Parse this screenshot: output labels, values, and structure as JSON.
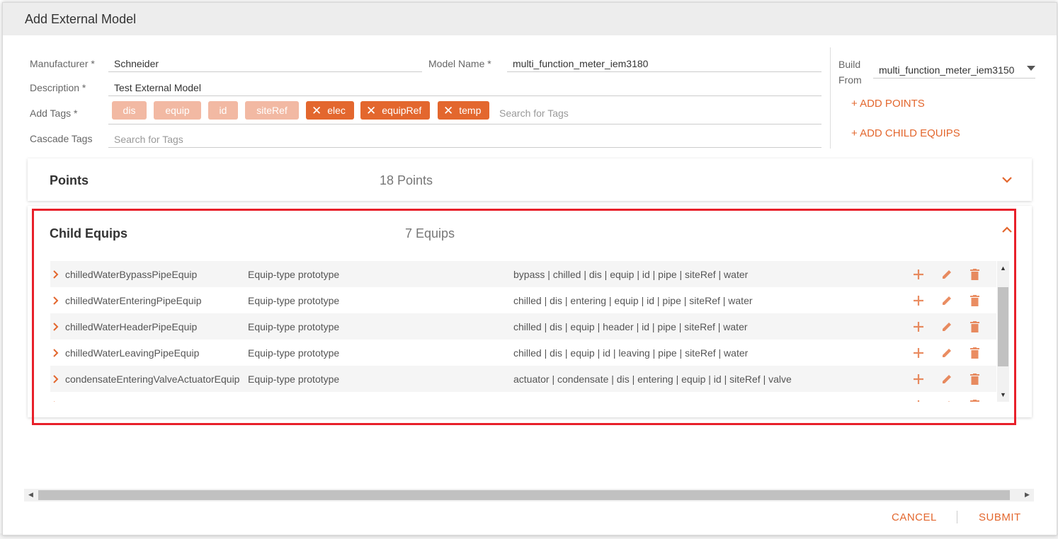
{
  "modal": {
    "title": "Add External Model"
  },
  "form": {
    "manufacturer_label": "Manufacturer *",
    "manufacturer_value": "Schneider",
    "model_name_label": "Model Name *",
    "model_name_value": "multi_function_meter_iem3180",
    "description_label": "Description *",
    "description_value": "Test External Model",
    "add_tags_label": "Add Tags *",
    "tags_fixed": [
      "dis",
      "equip",
      "id",
      "siteRef"
    ],
    "tags_removable": [
      "elec",
      "equipRef",
      "temp"
    ],
    "tags_search_placeholder": "Search for Tags",
    "cascade_tags_label": "Cascade Tags",
    "cascade_search_placeholder": "Search for Tags"
  },
  "right_panel": {
    "build_label_1": "Build",
    "build_label_2": "From",
    "build_from_value": "multi_function_meter_iem3150",
    "add_points": "+ ADD POINTS",
    "add_child_equips": "+ ADD CHILD EQUIPS"
  },
  "points_card": {
    "title": "Points",
    "count": "18 Points"
  },
  "child_equips_card": {
    "title": "Child Equips",
    "count": "7 Equips",
    "rows": [
      {
        "name": "chilledWaterBypassPipeEquip",
        "type": "Equip-type prototype",
        "tags": "bypass | chilled | dis | equip | id | pipe | siteRef | water"
      },
      {
        "name": "chilledWaterEnteringPipeEquip",
        "type": "Equip-type prototype",
        "tags": "chilled | dis | entering | equip | id | pipe | siteRef | water"
      },
      {
        "name": "chilledWaterHeaderPipeEquip",
        "type": "Equip-type prototype",
        "tags": "chilled | dis | equip | header | id | pipe | siteRef | water"
      },
      {
        "name": "chilledWaterLeavingPipeEquip",
        "type": "Equip-type prototype",
        "tags": "chilled | dis | equip | id | leaving | pipe | siteRef | water"
      },
      {
        "name": "condensateEnteringValveActuatorEquip",
        "type": "Equip-type prototype",
        "tags": "actuator | condensate | dis | entering | equip | id | siteRef | valve"
      }
    ]
  },
  "footer": {
    "cancel": "CANCEL",
    "submit": "SUBMIT"
  },
  "colors": {
    "accent": "#e3672e",
    "tag_light": "#f2b9a3",
    "highlight": "#e8202a"
  }
}
